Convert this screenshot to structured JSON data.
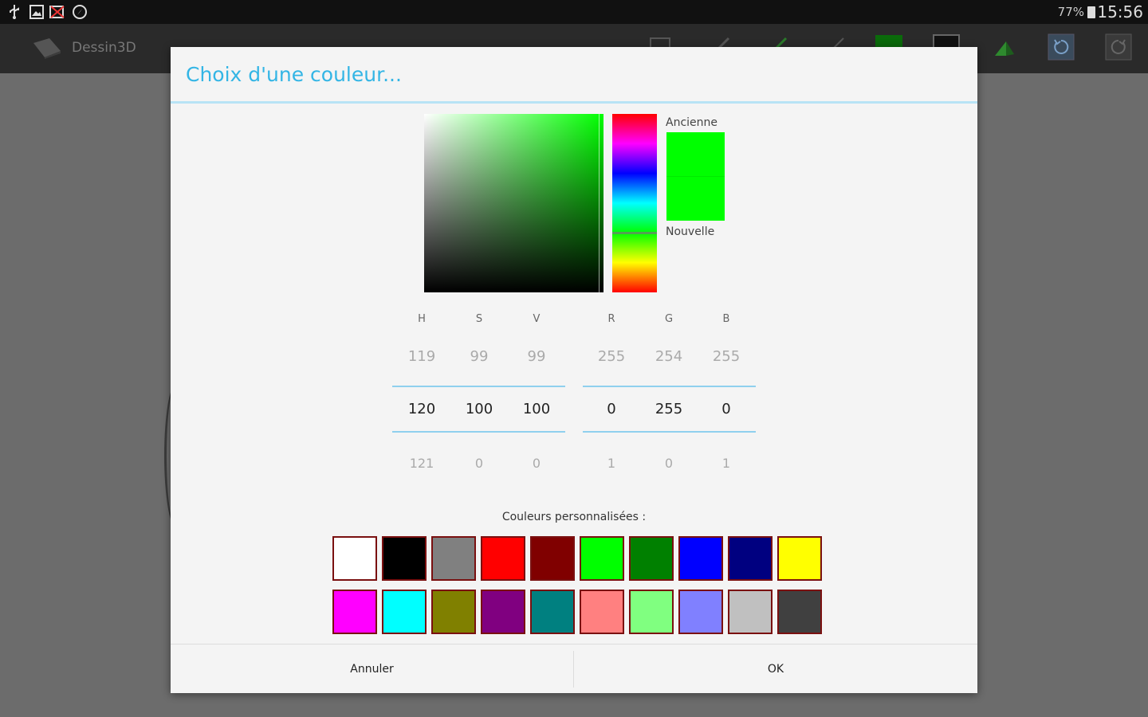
{
  "status_bar": {
    "time": "15:56",
    "battery": "77%",
    "icons": [
      "usb-icon",
      "gallery-icon",
      "no-signal-icon",
      "compass-icon"
    ]
  },
  "app": {
    "title": "Dessin3D",
    "toolbar_icons": [
      "rectangle-icon",
      "pencil-icon",
      "green-pen-icon",
      "line-icon",
      "fill-color-icon",
      "stroke-color-icon",
      "shape-icon",
      "undo-icon",
      "redo-icon"
    ]
  },
  "dialog": {
    "title": "Choix d'une couleur...",
    "old_label": "Ancienne",
    "new_label": "Nouvelle",
    "old_color": "#00ff00",
    "new_color": "#00ff00",
    "hsv": {
      "headers": [
        "H",
        "S",
        "V"
      ],
      "prev": [
        "119",
        "99",
        "99"
      ],
      "current": [
        "120",
        "100",
        "100"
      ],
      "next": [
        "121",
        "0",
        "0"
      ]
    },
    "rgb": {
      "headers": [
        "R",
        "G",
        "B"
      ],
      "prev": [
        "255",
        "254",
        "255"
      ],
      "current": [
        "0",
        "255",
        "0"
      ],
      "next": [
        "1",
        "0",
        "1"
      ]
    },
    "custom_label": "Couleurs personnalisées :",
    "custom_colors": [
      "#ffffff",
      "#000000",
      "#808080",
      "#ff0000",
      "#800000",
      "#00ff00",
      "#008000",
      "#0000ff",
      "#000080",
      "#ffff00",
      "#ff00ff",
      "#00ffff",
      "#808000",
      "#800080",
      "#008080",
      "#ff8080",
      "#80ff80",
      "#8080ff",
      "#c0c0c0",
      "#404040"
    ],
    "cancel_label": "Annuler",
    "ok_label": "OK"
  }
}
